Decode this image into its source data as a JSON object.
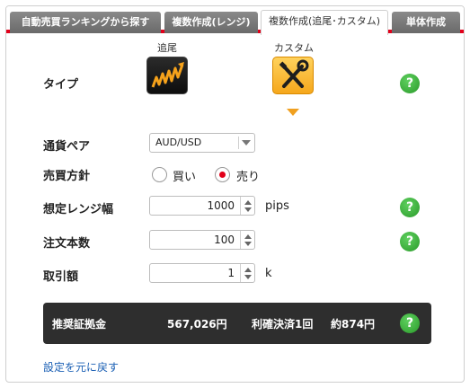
{
  "tabs": [
    {
      "label": "自動売買ランキングから探す",
      "active": false
    },
    {
      "label": "複数作成(レンジ)",
      "active": false
    },
    {
      "label": "複数作成(追尾･カスタム)",
      "active": true
    },
    {
      "label": "単体作成",
      "active": false
    }
  ],
  "type_row": {
    "label": "タイプ",
    "option_trail": "追尾",
    "option_custom": "カスタム",
    "selected": "カスタム"
  },
  "currency_pair": {
    "label": "通貨ペア",
    "value": "AUD/USD"
  },
  "direction": {
    "label": "売買方針",
    "buy": "買い",
    "sell": "売り",
    "selected": "売り"
  },
  "range_width": {
    "label": "想定レンジ幅",
    "value": "1000",
    "unit": "pips"
  },
  "order_count": {
    "label": "注文本数",
    "value": "100"
  },
  "trade_amount": {
    "label": "取引額",
    "value": "1",
    "unit": "k"
  },
  "summary": {
    "label": "推奨証拠金",
    "margin": "567,026円",
    "take_profit": "利確決済1回",
    "approx": "約874円"
  },
  "help_glyph": "?",
  "reset_link": "設定を元に戻す",
  "colors": {
    "accent_red": "#e2001a",
    "help_green": "#3cb43c",
    "link_blue": "#1a5fb4",
    "custom_orange": "#f5a71c"
  }
}
